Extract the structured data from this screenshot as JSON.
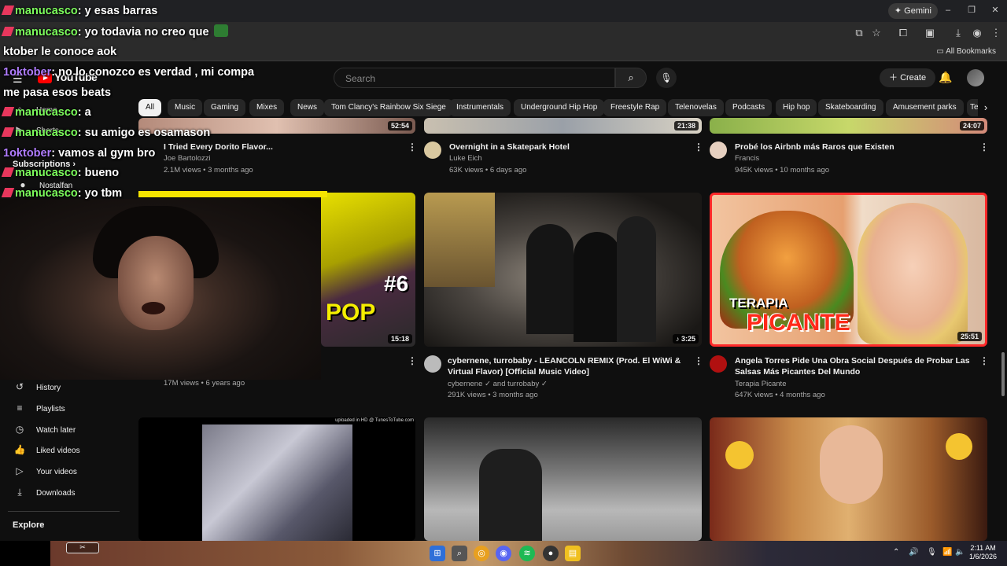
{
  "browser": {
    "gemini_label": "Gemini",
    "all_bookmarks": "All Bookmarks"
  },
  "youtube": {
    "logo": "YouTube",
    "search_placeholder": "Search",
    "create_label": "Create",
    "chips": [
      "All",
      "Music",
      "Gaming",
      "Mixes",
      "News",
      "Tom Clancy's Rainbow Six Siege",
      "Instrumentals",
      "Underground Hip Hop",
      "Freestyle Rap",
      "Telenovelas",
      "Podcasts",
      "Hip hop",
      "Skateboarding",
      "Amusement parks",
      "Te"
    ],
    "sidebar": {
      "home": "Home",
      "shorts": "Shorts",
      "subscriptions": "Subscriptions",
      "sub_channel": "Nostalfan",
      "you_items": [
        "History",
        "Playlists",
        "Watch later",
        "Liked videos",
        "Your videos",
        "Downloads"
      ],
      "explore": "Explore"
    },
    "videos_row1": [
      {
        "title": "I Tried Every Dorito Flavor...",
        "channel": "Joe Bartolozzi",
        "meta": "2.1M views • 3 months ago",
        "duration": "52:54"
      },
      {
        "title": "Overnight in a Skatepark Hotel",
        "channel": "Luke Eich",
        "meta": "63K views • 6 days ago",
        "duration": "21:38"
      },
      {
        "title": "Probé los Airbnb más Raros que Existen",
        "channel": "Francis",
        "meta": "945K views • 10 months ago",
        "duration": "24:07"
      }
    ],
    "videos_row2": [
      {
        "title": "",
        "channel": "",
        "meta": "17M views • 6 years ago",
        "duration": "15:18",
        "thumb_text": "#6",
        "thumb_text2": "POP"
      },
      {
        "title": "cybernene, turrobaby - LEANCOLN REMIX (Prod. El WiWi & Virtual Flavor) [Official Music Video]",
        "channel": "cybernene",
        "channel2": "and turrobaby",
        "meta": "291K views • 3 months ago",
        "duration": "3:25"
      },
      {
        "title": "Angela Torres Pide Una Obra Social Después de Probar Las Salsas Más Picantes Del Mundo",
        "channel": "Terapia Picante",
        "meta": "647K views • 4 months ago",
        "duration": "25:51",
        "thumb_text": "TERAPIA",
        "thumb_text2": "PICANTE"
      }
    ],
    "row3_caption": "uploaded in HD @ TunesToTube.com"
  },
  "chat_overlay": [
    {
      "user": "manucasco",
      "color": "green",
      "message": "y esas barras"
    },
    {
      "user": "manucasco",
      "color": "green",
      "message": "yo todavia no creo que"
    },
    {
      "user": "",
      "color": "white",
      "message": "ktober le conoce aok"
    },
    {
      "user": "1oktober",
      "color": "purple",
      "message": "no lo conozco es verdad , mi compa"
    },
    {
      "user": "",
      "color": "white",
      "message": "me pasa esos beats"
    },
    {
      "user": "manucasco",
      "color": "green",
      "message": "a"
    },
    {
      "user": "manucasco",
      "color": "green",
      "message": "su amigo es osamason"
    },
    {
      "user": "1oktober",
      "color": "purple",
      "message": "vamos al gym bro"
    },
    {
      "user": "manucasco",
      "color": "green",
      "message": "bueno"
    },
    {
      "user": "manucasco",
      "color": "green",
      "message": "yo tbm"
    }
  ],
  "taskbar": {
    "time": "2:11 AM",
    "date": "1/6/2026"
  },
  "colors": {
    "youtube_red": "#ff0000",
    "chat_green": "#7cfc5c",
    "chat_purple": "#b07cff",
    "highlight_border": "#ff2a2a"
  }
}
